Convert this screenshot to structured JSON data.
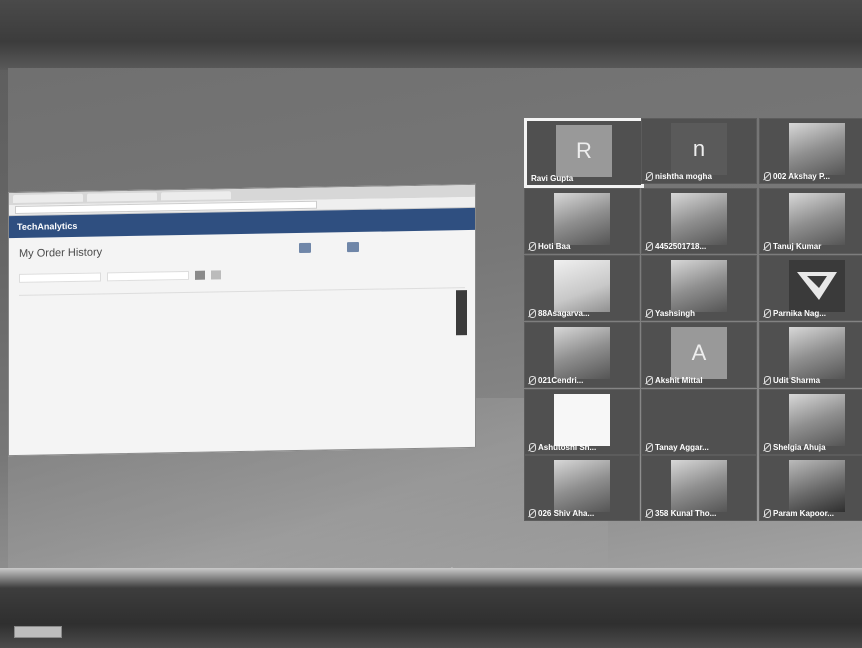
{
  "shared_screen": {
    "tabs": [
      "",
      "",
      ""
    ],
    "address": "",
    "brand": "TechAnalytics",
    "nav_items": [
      "",
      "",
      "",
      "",
      ""
    ],
    "page_title": "My Order History",
    "button_1": "",
    "button_2": "",
    "table_headers": [
      "",
      "",
      "",
      "",
      "",
      "",
      "",
      ""
    ],
    "row_cells": [
      "",
      "",
      "",
      "",
      "",
      "",
      "",
      ""
    ],
    "side_handle": ""
  },
  "participants": [
    {
      "name": "Ravi Gupta",
      "avatar_letter": "R",
      "avatar_type": "letter",
      "active": true
    },
    {
      "name": "nishtha mogha",
      "avatar_letter": "n",
      "avatar_type": "letter-dark"
    },
    {
      "name": "002 Akshay P...",
      "avatar_type": "photo"
    },
    {
      "name": "Hoti Baa",
      "avatar_type": "photo"
    },
    {
      "name": "4452501718...",
      "avatar_type": "photo"
    },
    {
      "name": "Tanuj Kumar",
      "avatar_type": "photo"
    },
    {
      "name": "88Asagarva...",
      "avatar_type": "photo-light"
    },
    {
      "name": "Yashsingh",
      "avatar_type": "photo"
    },
    {
      "name": "Parnika Nag...",
      "avatar_type": "logo"
    },
    {
      "name": "021Cendri...",
      "avatar_type": "photo"
    },
    {
      "name": "Akshit Mittal",
      "avatar_letter": "A",
      "avatar_type": "letter"
    },
    {
      "name": "Udit Sharma",
      "avatar_type": "photo"
    },
    {
      "name": "Ashutoshi Sh...",
      "avatar_type": "blank"
    },
    {
      "name": "Tanay Aggar...",
      "avatar_type": "none"
    },
    {
      "name": "Shelgia Ahuja",
      "avatar_type": "photo"
    },
    {
      "name": "026 Shiv Aha...",
      "avatar_type": "photo"
    },
    {
      "name": "358 Kunal Tho...",
      "avatar_type": "photo"
    },
    {
      "name": "Param Kapoor...",
      "avatar_type": "photo-dark"
    }
  ]
}
